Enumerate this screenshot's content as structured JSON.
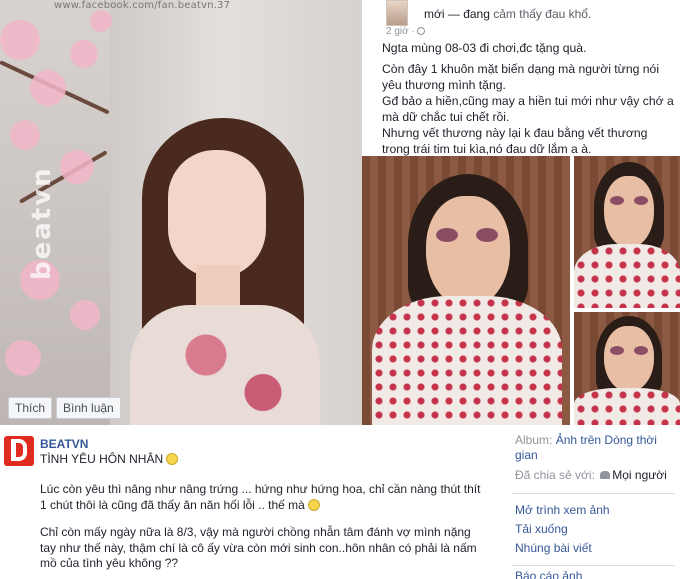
{
  "photo": {
    "watermark_url": "www.facebook.com/fan.beatvn.37",
    "watermark_brand": "beatvn",
    "actions": [
      "Thích",
      "Bình luận"
    ]
  },
  "embedded_post": {
    "status_prefix": "mới — đang",
    "status_feeling": "cảm thấy đau khổ.",
    "time": "2 giờ ·",
    "paragraphs": [
      "Ngta mùng 08-03 đi chơi,đc tặng quà.",
      "Còn đây 1 khuôn mặt biến dạng mà người từng nói yêu thương mình tặng.",
      "Gđ bảo a hiền,cũng may a hiền tui mới như vậy chớ a mà dữ chắc tui chết rồi.",
      "Nhưng vết thương này lại k đau bằng vết thương trong trái tim tui kìa,nó đau dữ lắm a à."
    ]
  },
  "post": {
    "page_name": "BEATVN",
    "title": "TÌNH YÊU HÔN NHÂN",
    "paragraphs": [
      "Lúc còn yêu thì nâng như nâng trứng ... hứng như hứng hoa, chỉ cần nàng thút thít 1 chút thôi là cũng đã thấy ăn năn hối lỗi .. thế mà",
      "Chỉ còn mấy ngày nữa là 8/3, vậy mà người chồng nhẫn tâm đánh vợ mình nặng tay như thế này, thậm chí là cô ấy vừa còn mới sinh con..hôn nhân có phải là nấm mồ của tình yêu không ??"
    ]
  },
  "sidebar": {
    "album_label": "Album:",
    "album_link": "Ảnh trên Dòng thời gian",
    "shared_label": "Đã chia sẻ với:",
    "shared_value": "Mọi người",
    "links": [
      "Mở trình xem ảnh",
      "Tải xuống",
      "Nhúng bài viết",
      "Báo cáo ảnh"
    ]
  }
}
